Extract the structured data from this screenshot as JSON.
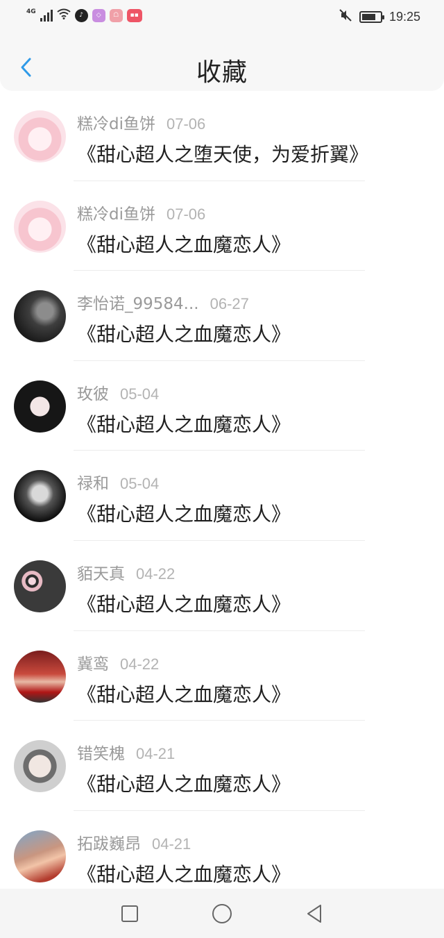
{
  "status": {
    "network": "4G",
    "time": "19:25",
    "battery_level": 0.75,
    "app_badges": [
      "tiktok-icon",
      "app-icon-purple",
      "app-icon-pink",
      "app-icon-red"
    ]
  },
  "header": {
    "title": "收藏",
    "back_icon": "chevron-left-icon"
  },
  "colors": {
    "accent": "#2f9ae8",
    "title": "#222222",
    "meta": "#9a9a9a",
    "book": "#1f1f1f"
  },
  "items": [
    {
      "user": "糕冷di鱼饼",
      "date": "07-06",
      "book": "《甜心超人之堕天使，为爱折翼》",
      "avatar": "avatar-pink-anime"
    },
    {
      "user": "糕冷di鱼饼",
      "date": "07-06",
      "book": "《甜心超人之血魔恋人》",
      "avatar": "avatar-pink-anime"
    },
    {
      "user": "李怡诺_99584...",
      "date": "06-27",
      "book": "《甜心超人之血魔恋人》",
      "avatar": "avatar-dark-photo"
    },
    {
      "user": "玫彼",
      "date": "05-04",
      "book": "《甜心超人之血魔恋人》",
      "avatar": "avatar-anime-girl"
    },
    {
      "user": "禄和",
      "date": "05-04",
      "book": "《甜心超人之血魔恋人》",
      "avatar": "avatar-bw-man"
    },
    {
      "user": "貊天真",
      "date": "04-22",
      "book": "《甜心超人之血魔恋人》",
      "avatar": "avatar-flowers"
    },
    {
      "user": "冀鸾",
      "date": "04-22",
      "book": "《甜心超人之血魔恋人》",
      "avatar": "avatar-red-girl"
    },
    {
      "user": "错笑槐",
      "date": "04-21",
      "book": "《甜心超人之血魔恋人》",
      "avatar": "avatar-sketch-girl"
    },
    {
      "user": "拓跋巍昂",
      "date": "04-21",
      "book": "《甜心超人之血魔恋人》",
      "avatar": "avatar-child"
    }
  ],
  "navbar": {
    "buttons": [
      "recent-apps-icon",
      "home-icon",
      "back-triangle-icon"
    ]
  }
}
